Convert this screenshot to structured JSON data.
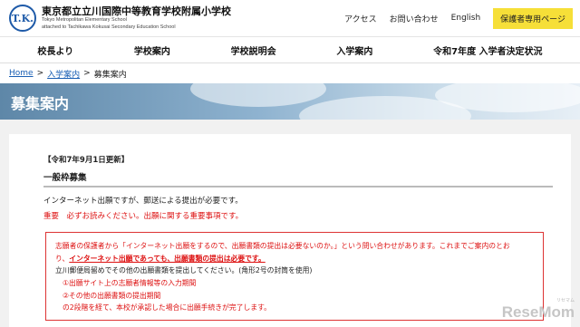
{
  "header": {
    "logo_text": "T.K.",
    "school_name_jp": "東京都立立川国際中等教育学校附属小学校",
    "school_name_en1": "Tokyo Metropolitan Elementary School",
    "school_name_en2": "attached to Tachikawa Kokusai Secondary Education School",
    "links": [
      "アクセス",
      "お問い合わせ",
      "English"
    ],
    "parent_button": "保護者専用ページ"
  },
  "nav": [
    "校長より",
    "学校案内",
    "学校説明会",
    "入学案内",
    "令和7年度 入学者決定状況"
  ],
  "breadcrumb": {
    "home": "Home",
    "sep1": ">",
    "parent": "入学案内",
    "sep2": ">",
    "current": "募集案内"
  },
  "hero": {
    "title": "募集案内"
  },
  "content": {
    "update": "【令和7年9月1日更新】",
    "section_title": "一般枠募集",
    "lead": "インターネット出願ですが、郵送による提出が必要です。",
    "important": "重要　必ずお読みください。出願に関する重要事項です。",
    "notice": {
      "line1": "志願者の保護者から「インターネット出願をするので、出願書類の提出は必要ないのか。」という問い合わせがあります。これまでご案内のとお",
      "line2_prefix": "り、",
      "line2_emph": "インターネット出願であっても、出願書類の提出は必要です。",
      "line3": "立川郵便局留めでその他の出願書類を提出してください。(角形2号の封筒を使用)",
      "item1": "①出願サイト上の志願者情報等の入力期間",
      "item2": "②その他の出願書類の提出期間",
      "line_last": "の2段階を経て、本校が承認した場合に出願手続きが完了します。"
    }
  },
  "watermark": {
    "jp": "リセマム",
    "en": "ReseMom"
  }
}
